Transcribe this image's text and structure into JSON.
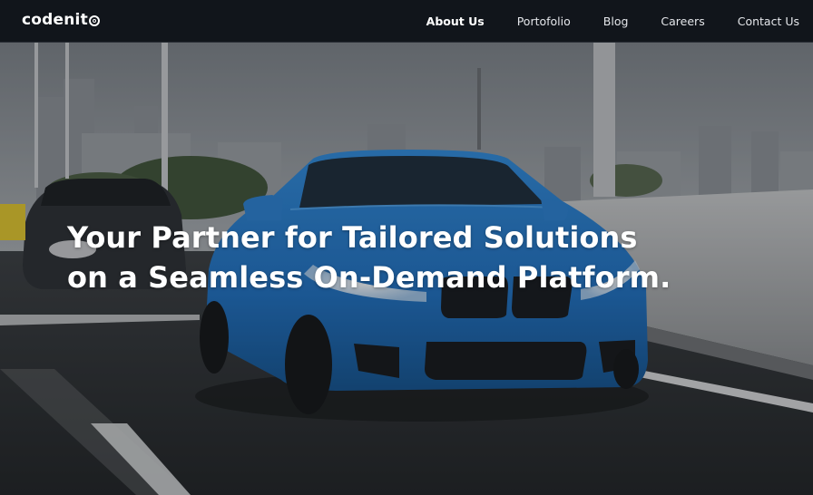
{
  "brand": {
    "name": "codenit",
    "mark_icon": "logo-ring-icon"
  },
  "nav": {
    "items": [
      {
        "label": "About Us",
        "active": true
      },
      {
        "label": "Portofolio",
        "active": false
      },
      {
        "label": "Blog",
        "active": false
      },
      {
        "label": "Careers",
        "active": false
      },
      {
        "label": "Contact Us",
        "active": false
      }
    ]
  },
  "hero": {
    "title_line1": "Your Partner for Tailored Solutions",
    "title_line2": "on a Seamless On-Demand Platform.",
    "image_subject": "blue sports coupe driving on a highway overpass, dark sedan behind, city skyline in background",
    "accent_color": "#2a7fd4"
  },
  "colors": {
    "navbar_bg": "#11151b",
    "text_primary": "#ffffff"
  }
}
